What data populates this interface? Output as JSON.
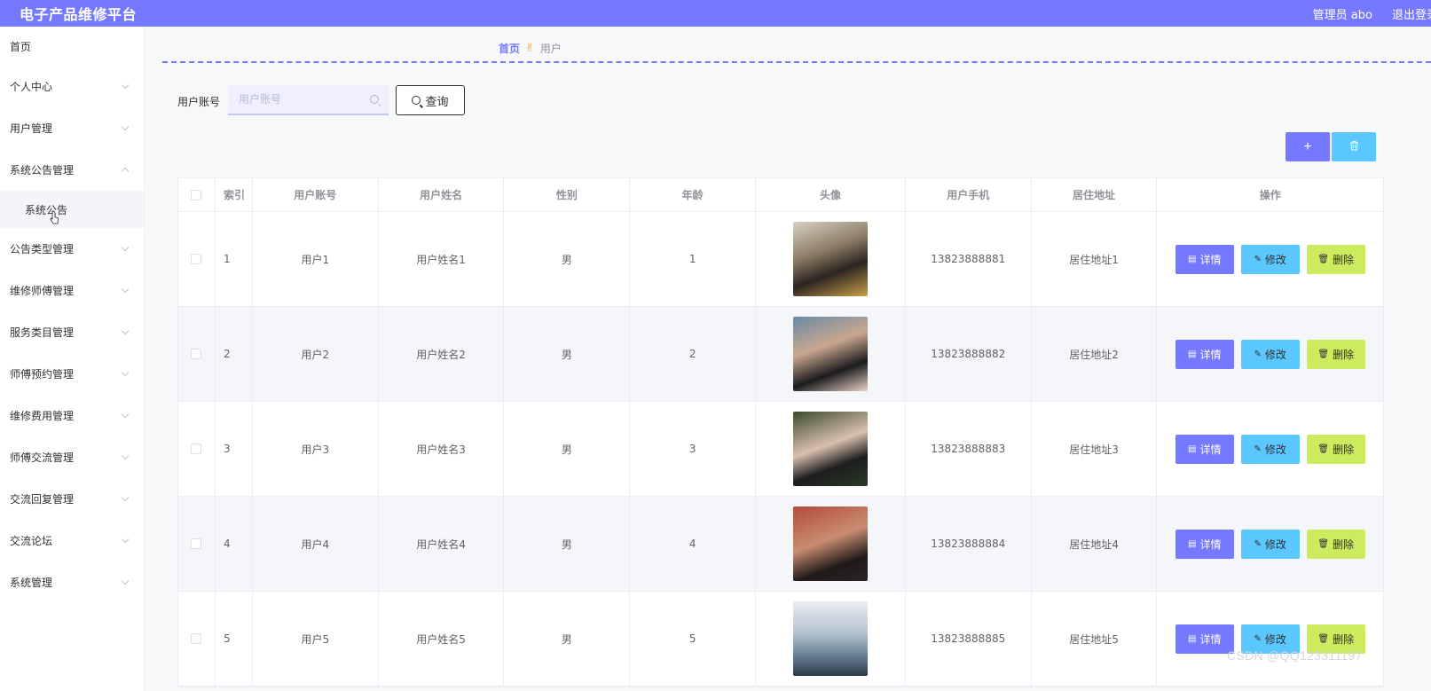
{
  "header": {
    "title": "电子产品维修平台",
    "user": "管理员 abo",
    "logout": "退出登录"
  },
  "sidebar": {
    "items": [
      {
        "label": "首页",
        "has_chevron": false
      },
      {
        "label": "个人中心",
        "has_chevron": true
      },
      {
        "label": "用户管理",
        "has_chevron": true
      },
      {
        "label": "系统公告管理",
        "has_chevron": true,
        "expanded": true
      },
      {
        "label": "系统公告",
        "sub": true
      },
      {
        "label": "公告类型管理",
        "has_chevron": true
      },
      {
        "label": "维修师傅管理",
        "has_chevron": true
      },
      {
        "label": "服务类目管理",
        "has_chevron": true
      },
      {
        "label": "师傅预约管理",
        "has_chevron": true
      },
      {
        "label": "维修费用管理",
        "has_chevron": true
      },
      {
        "label": "师傅交流管理",
        "has_chevron": true
      },
      {
        "label": "交流回复管理",
        "has_chevron": true
      },
      {
        "label": "交流论坛",
        "has_chevron": true
      },
      {
        "label": "系统管理",
        "has_chevron": true
      }
    ]
  },
  "breadcrumb": {
    "home": "首页",
    "current": "用户"
  },
  "search": {
    "label": "用户账号",
    "placeholder": "用户账号",
    "value": "",
    "button": "查询"
  },
  "toolbar": {
    "add": "+",
    "delete_icon": "trash-icon"
  },
  "table": {
    "columns": [
      "索引",
      "用户账号",
      "用户姓名",
      "性别",
      "年龄",
      "头像",
      "用户手机",
      "居住地址",
      "操作"
    ],
    "rows": [
      {
        "index": "1",
        "account": "用户1",
        "name": "用户姓名1",
        "gender": "男",
        "age": "1",
        "phone": "13823888881",
        "address": "居住地址1"
      },
      {
        "index": "2",
        "account": "用户2",
        "name": "用户姓名2",
        "gender": "男",
        "age": "2",
        "phone": "13823888882",
        "address": "居住地址2"
      },
      {
        "index": "3",
        "account": "用户3",
        "name": "用户姓名3",
        "gender": "男",
        "age": "3",
        "phone": "13823888883",
        "address": "居住地址3"
      },
      {
        "index": "4",
        "account": "用户4",
        "name": "用户姓名4",
        "gender": "男",
        "age": "4",
        "phone": "13823888884",
        "address": "居住地址4"
      },
      {
        "index": "5",
        "account": "用户5",
        "name": "用户姓名5",
        "gender": "男",
        "age": "5",
        "phone": "13823888885",
        "address": "居住地址5"
      }
    ],
    "actions": {
      "detail": "详情",
      "edit": "修改",
      "delete": "删除"
    }
  },
  "watermark": "CSDN @QQ123311197",
  "colors": {
    "primary": "#7579ff",
    "info": "#5bc7ff",
    "lime": "#cdeb5f"
  }
}
